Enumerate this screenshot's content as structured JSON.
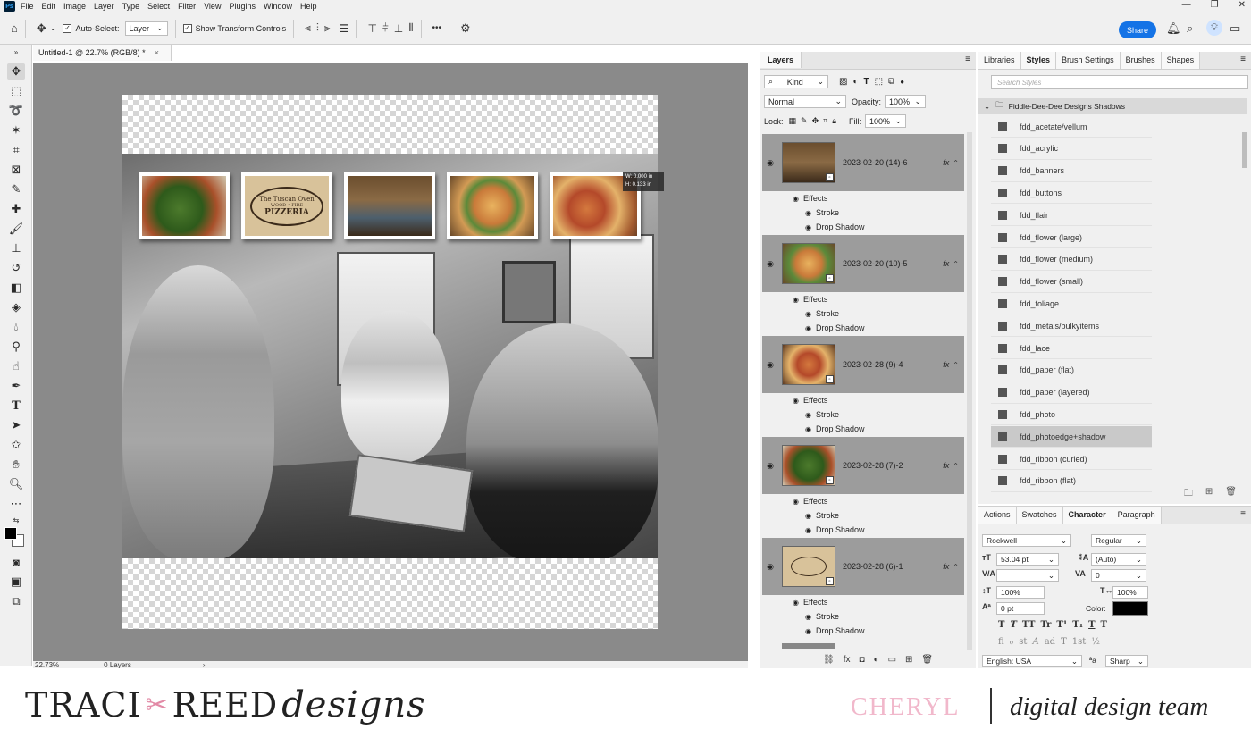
{
  "app": {
    "title": "Photoshop",
    "menu": [
      "File",
      "Edit",
      "Image",
      "Layer",
      "Type",
      "Select",
      "Filter",
      "View",
      "Plugins",
      "Window",
      "Help"
    ]
  },
  "options": {
    "auto_select_label": "Auto-Select:",
    "auto_select_target": "Layer",
    "transform_label": "Show Transform Controls",
    "more": "•••",
    "share_label": "Share"
  },
  "document": {
    "tab_title": "Untitled-1 @ 22.7% (RGB/8) *",
    "zoom": "22.73%",
    "layers_count": "0 Layers",
    "measure": [
      "W: 0.000 in",
      "H: 0.133 in"
    ],
    "logo_lines": [
      "The Tuscan Oven",
      "WOOD • FIRE",
      "PIZZERIA"
    ]
  },
  "layers_panel": {
    "tab": "Layers",
    "filter": "Kind",
    "blend_mode": "Normal",
    "opacity_label": "Opacity:",
    "opacity": "100%",
    "lock_label": "Lock:",
    "fill_label": "Fill:",
    "fill": "100%",
    "layers": [
      {
        "name": "2023-02-20 (14)-6",
        "fx": "fx",
        "effects": "Effects",
        "e1": "Stroke",
        "e2": "Drop Shadow"
      },
      {
        "name": "2023-02-20 (10)-5",
        "fx": "fx",
        "effects": "Effects",
        "e1": "Stroke",
        "e2": "Drop Shadow"
      },
      {
        "name": "2023-02-28 (9)-4",
        "fx": "fx",
        "effects": "Effects",
        "e1": "Stroke",
        "e2": "Drop Shadow"
      },
      {
        "name": "2023-02-28 (7)-2",
        "fx": "fx",
        "effects": "Effects",
        "e1": "Stroke",
        "e2": "Drop Shadow"
      },
      {
        "name": "2023-02-28 (6)-1",
        "fx": "fx",
        "effects": "Effects",
        "e1": "Stroke",
        "e2": "Drop Shadow"
      }
    ]
  },
  "styles_panel": {
    "tabs": [
      "Libraries",
      "Styles",
      "Brush Settings",
      "Brushes",
      "Shapes"
    ],
    "search_placeholder": "Search Styles",
    "group": "Fiddle-Dee-Dee Designs Shadows",
    "items": [
      "fdd_acetate/vellum",
      "fdd_acrylic",
      "fdd_banners",
      "fdd_buttons",
      "fdd_flair",
      "fdd_flower (large)",
      "fdd_flower (medium)",
      "fdd_flower (small)",
      "fdd_foliage",
      "fdd_metals/bulkyitems",
      "fdd_lace",
      "fdd_paper (flat)",
      "fdd_paper (layered)",
      "fdd_photo",
      "fdd_photoedge+shadow",
      "fdd_ribbon (curled)",
      "fdd_ribbon (flat)"
    ],
    "selected_index": 14
  },
  "character_panel": {
    "tabs": [
      "Actions",
      "Swatches",
      "Character",
      "Paragraph"
    ],
    "font": "Rockwell",
    "style": "Regular",
    "size": "53.04 pt",
    "leading": "(Auto)",
    "kerning": "",
    "tracking": "0",
    "vscale": "100%",
    "hscale": "100%",
    "baseline": "0 pt",
    "color_label": "Color:",
    "color": "#000000",
    "language": "English: USA",
    "aa_label": "ªa",
    "antialias": "Sharp",
    "glyphs_row1": [
      "T",
      "T",
      "TT",
      "Tr",
      "T¹",
      "T₁",
      "T",
      "Ŧ"
    ],
    "glyphs_row2": [
      "fi",
      "ℴ",
      "st",
      "A",
      "ad",
      "T",
      "1st",
      "½"
    ]
  },
  "branding": {
    "logo_left": "TRACI",
    "logo_right": "REED",
    "logo_script": "designs",
    "member": "CHERYL",
    "team": "digital design team"
  },
  "colors": {
    "ui_bg": "#f0f0f0",
    "canvas_bg": "#8a8a8a",
    "accent": "#1473e6",
    "layer_selected": "#9c9c9c",
    "brand_pink": "#f1b8cb"
  }
}
